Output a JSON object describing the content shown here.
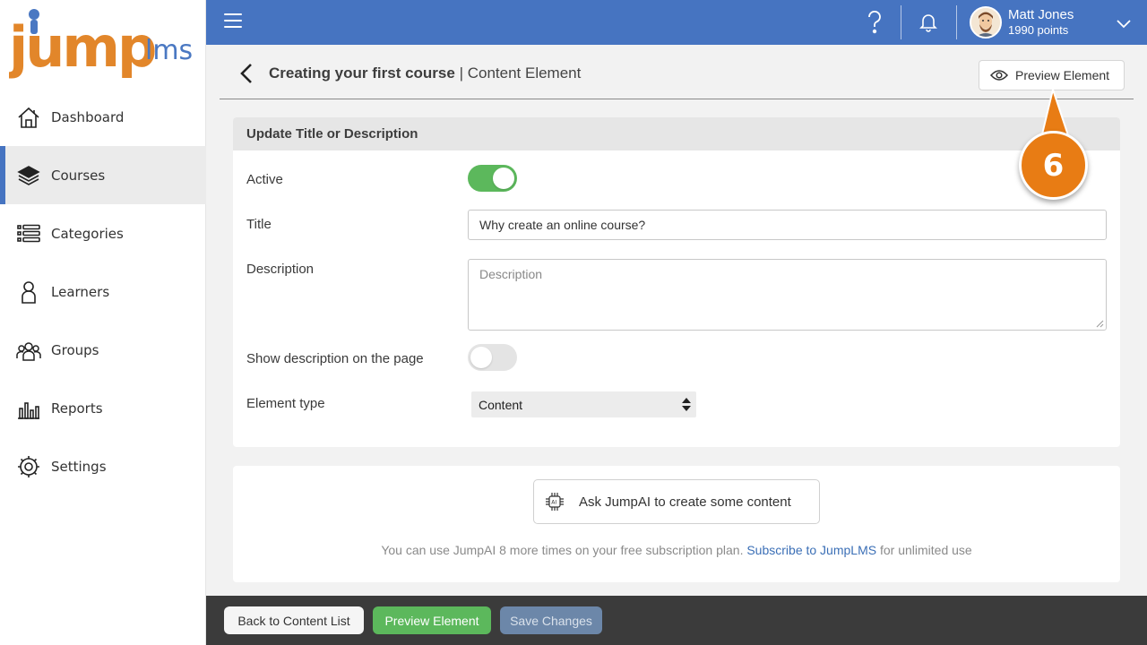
{
  "brand": {
    "logo_text": "jumplms",
    "accent": "#4674c1",
    "logo_orange": "#e2862a",
    "logo_blue": "#4a78c2"
  },
  "sidebar": {
    "items": [
      {
        "label": "Dashboard",
        "icon": "home-icon",
        "active": false
      },
      {
        "label": "Courses",
        "icon": "books-icon",
        "active": true
      },
      {
        "label": "Categories",
        "icon": "list-icon",
        "active": false
      },
      {
        "label": "Learners",
        "icon": "person-icon",
        "active": false
      },
      {
        "label": "Groups",
        "icon": "group-icon",
        "active": false
      },
      {
        "label": "Reports",
        "icon": "bar-chart-icon",
        "active": false
      },
      {
        "label": "Settings",
        "icon": "gear-icon",
        "active": false
      }
    ]
  },
  "topbar": {
    "user_name": "Matt Jones",
    "user_points": "1990 points",
    "icons": [
      "menu-icon",
      "help-icon",
      "bell-icon",
      "chevron-down-icon"
    ]
  },
  "header": {
    "course_title": "Creating your first course",
    "separator": "|",
    "section": "Content Element",
    "preview_label": "Preview Element"
  },
  "form": {
    "heading": "Update Title or Description",
    "active_label": "Active",
    "active_on": true,
    "title_label": "Title",
    "title_value": "Why create an online course?",
    "description_label": "Description",
    "description_placeholder": "Description",
    "show_desc_label": "Show description on the page",
    "show_desc_on": false,
    "element_type_label": "Element type",
    "element_type_value": "Content"
  },
  "ai": {
    "button_label": "Ask JumpAI to create some content",
    "note_prefix": "You can use JumpAI 8 more times on your free subscription plan.",
    "note_link": "Subscribe to JumpLMS",
    "note_suffix": "for unlimited use"
  },
  "footer": {
    "back_label": "Back to Content List",
    "preview_label": "Preview Element",
    "save_label": "Save Changes"
  },
  "step_marker": {
    "number": "6",
    "color": "#e87c14"
  }
}
